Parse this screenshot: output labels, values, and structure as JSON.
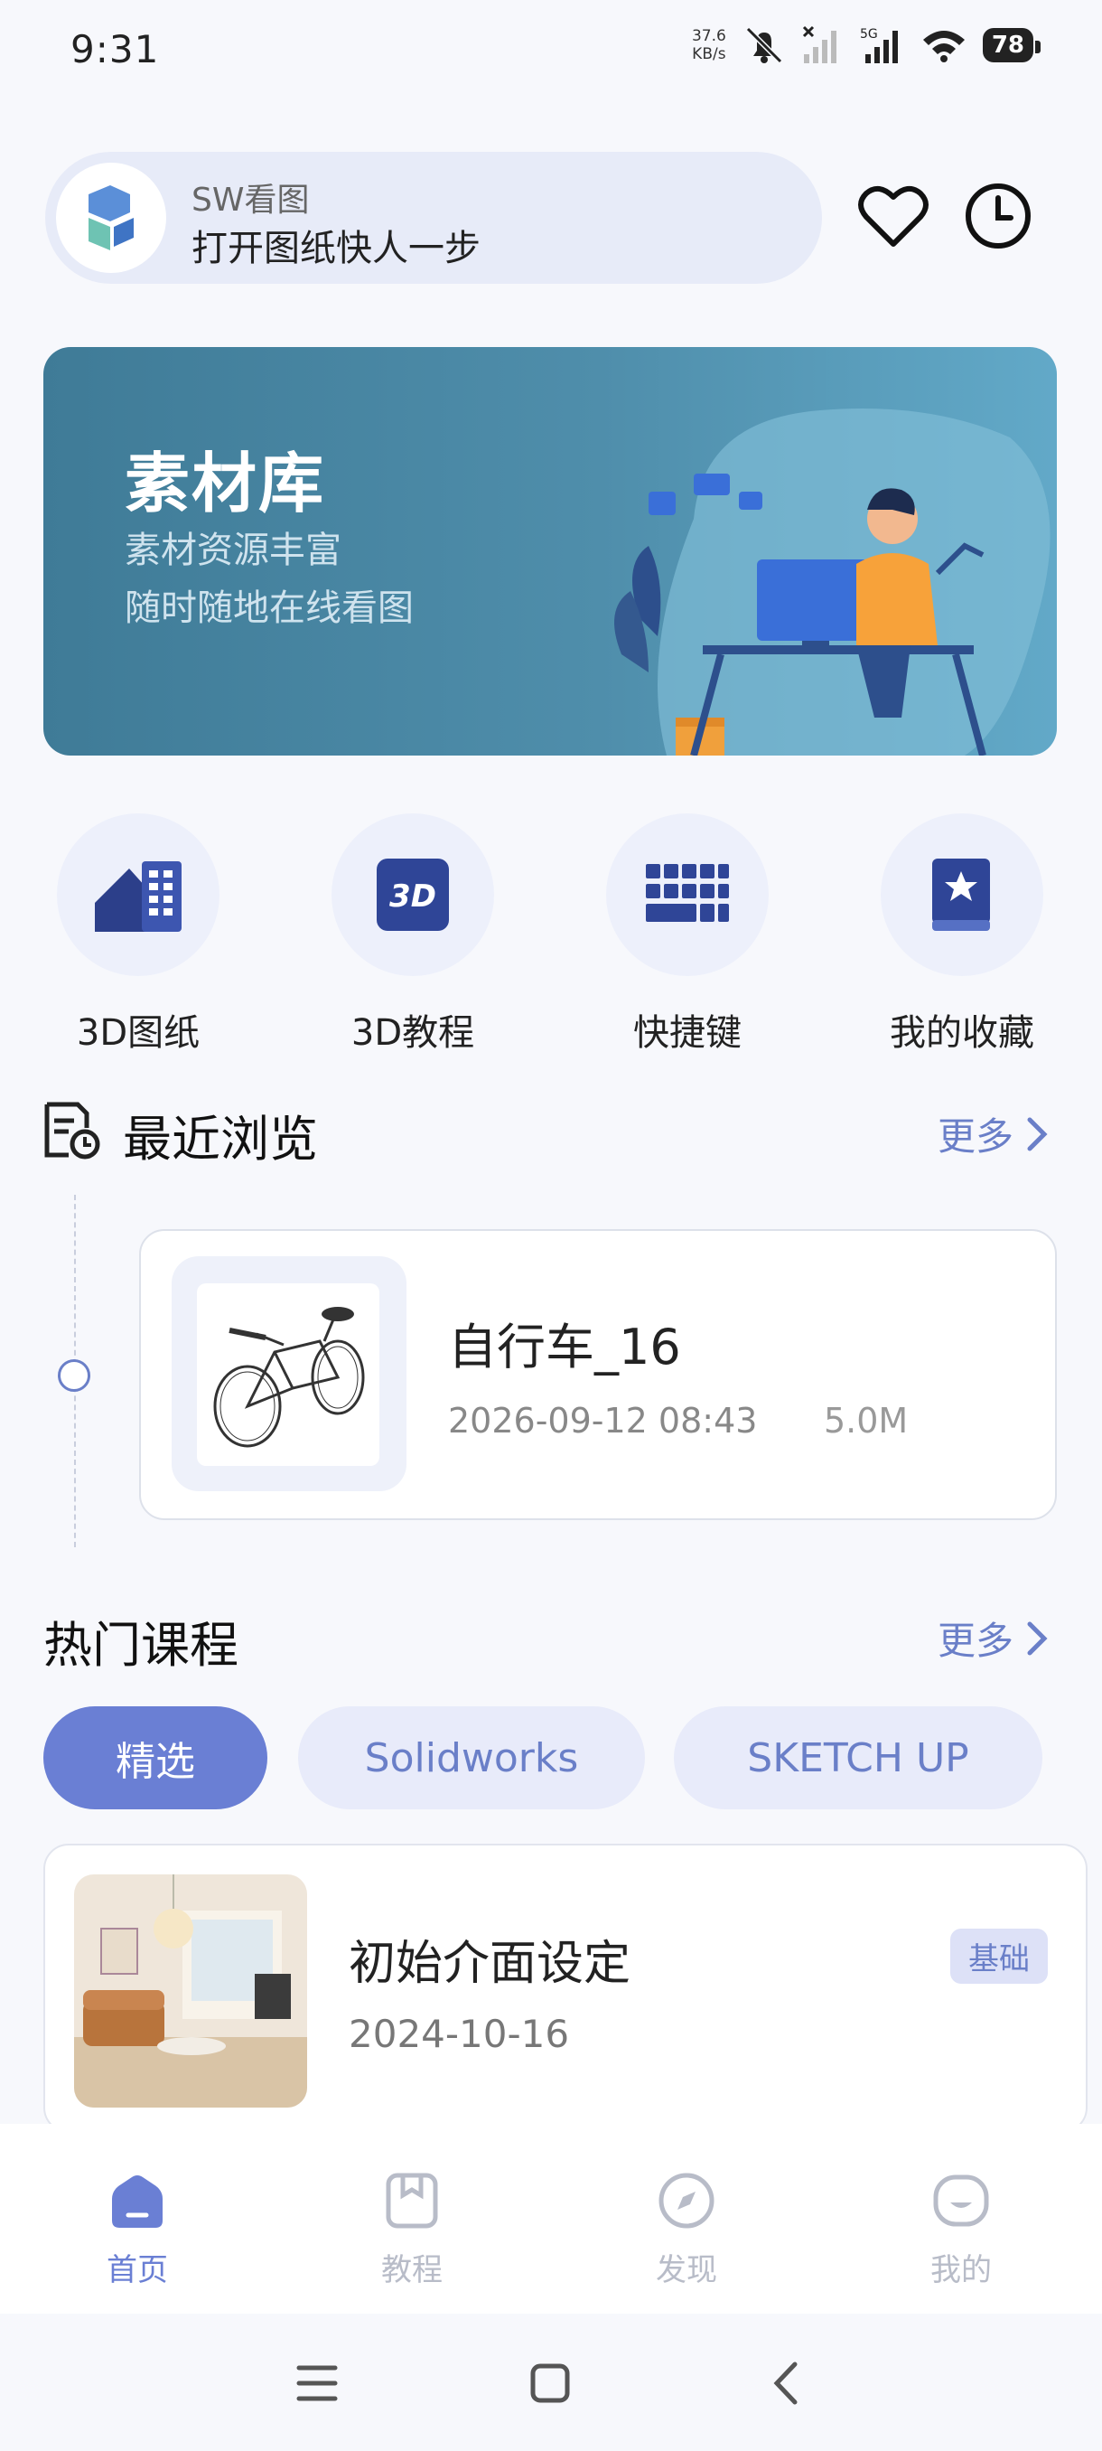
{
  "status_bar": {
    "time": "9:31",
    "net_speed_value": "37.6",
    "net_speed_unit": "KB/s",
    "network": "5G",
    "battery": "78"
  },
  "header": {
    "app_name": "SW看图",
    "slogan": "打开图纸快人一步",
    "favorite_icon": "heart-icon",
    "history_icon": "clock-icon"
  },
  "banner": {
    "title": "素材库",
    "subtitle_1": "素材资源丰富",
    "subtitle_2": "随时随地在线看图"
  },
  "quick_entries": [
    {
      "label": "3D图纸",
      "icon": "drawing-icon"
    },
    {
      "label": "3D教程",
      "icon": "3d-tutorial-icon",
      "icon_text": "3D"
    },
    {
      "label": "快捷键",
      "icon": "keyboard-icon"
    },
    {
      "label": "我的收藏",
      "icon": "bookmark-book-icon"
    }
  ],
  "recent": {
    "title": "最近浏览",
    "more": "更多",
    "items": [
      {
        "name": "自行车_16",
        "date": "2026-09-12 08:43",
        "size": "5.0M"
      }
    ]
  },
  "courses": {
    "title": "热门课程",
    "more": "更多",
    "tabs": [
      "精选",
      "Solidworks",
      "SKETCH UP"
    ],
    "active_tab": "精选",
    "items": [
      {
        "title": "初始介面设定",
        "date": "2024-10-16",
        "badge": "基础"
      }
    ]
  },
  "bottom_nav": [
    {
      "label": "首页",
      "active": true
    },
    {
      "label": "教程",
      "active": false
    },
    {
      "label": "发现",
      "active": false
    },
    {
      "label": "我的",
      "active": false
    }
  ],
  "colors": {
    "accent": "#6a7fd4",
    "banner": "#4f8eab",
    "background": "#f7f8fc"
  }
}
